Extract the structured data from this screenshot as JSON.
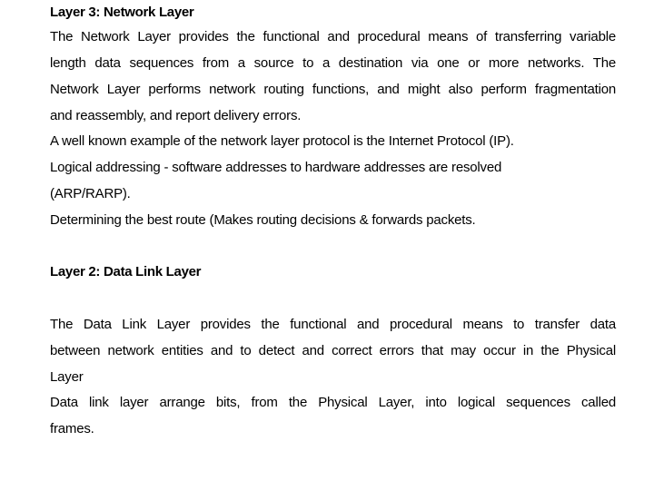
{
  "sections": [
    {
      "heading": "Layer 3: Network Layer",
      "lines": [
        "The Network Layer provides the functional and procedural means of transferring variable",
        "length data sequences from a source to a destination via one or more networks. The",
        "Network Layer performs network routing functions, and might also perform fragmentation",
        "and reassembly, and report delivery errors.",
        "A well known example of the network layer protocol is the Internet Protocol (IP).",
        "Logical addressing - software addresses to hardware addresses are resolved",
        "(ARP/RARP).",
        "Determining the best route (Makes routing decisions & forwards packets."
      ]
    },
    {
      "heading": "Layer 2: Data Link  Layer",
      "lines": [
        "The Data Link Layer provides the functional and procedural means to transfer data",
        "between network entities and to detect and correct errors that may occur in the Physical",
        "Layer",
        "Data link layer arrange bits, from the Physical Layer, into logical sequences called",
        "frames."
      ]
    }
  ]
}
